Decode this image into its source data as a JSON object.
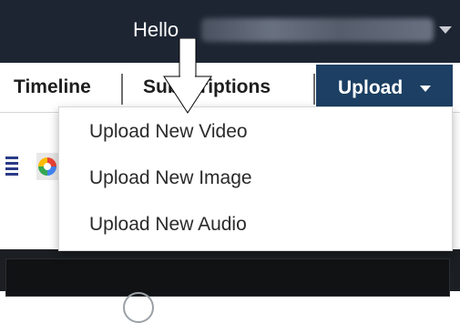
{
  "header": {
    "greeting": "Hello",
    "user_caret_icon": "caret-down-icon",
    "background": "#1d2533"
  },
  "nav": {
    "tabs": [
      {
        "label": "Timeline"
      },
      {
        "label": "Subscriptions"
      },
      {
        "label": "Upload",
        "active": true,
        "caret_icon": "caret-down-icon"
      }
    ],
    "active_color": "#1c3f63"
  },
  "upload_menu": {
    "items": [
      {
        "label": "Upload New Video"
      },
      {
        "label": "Upload New Image"
      },
      {
        "label": "Upload New Audio"
      }
    ]
  },
  "annotation": {
    "icon": "arrow-down-icon",
    "color": "#ffffff"
  }
}
